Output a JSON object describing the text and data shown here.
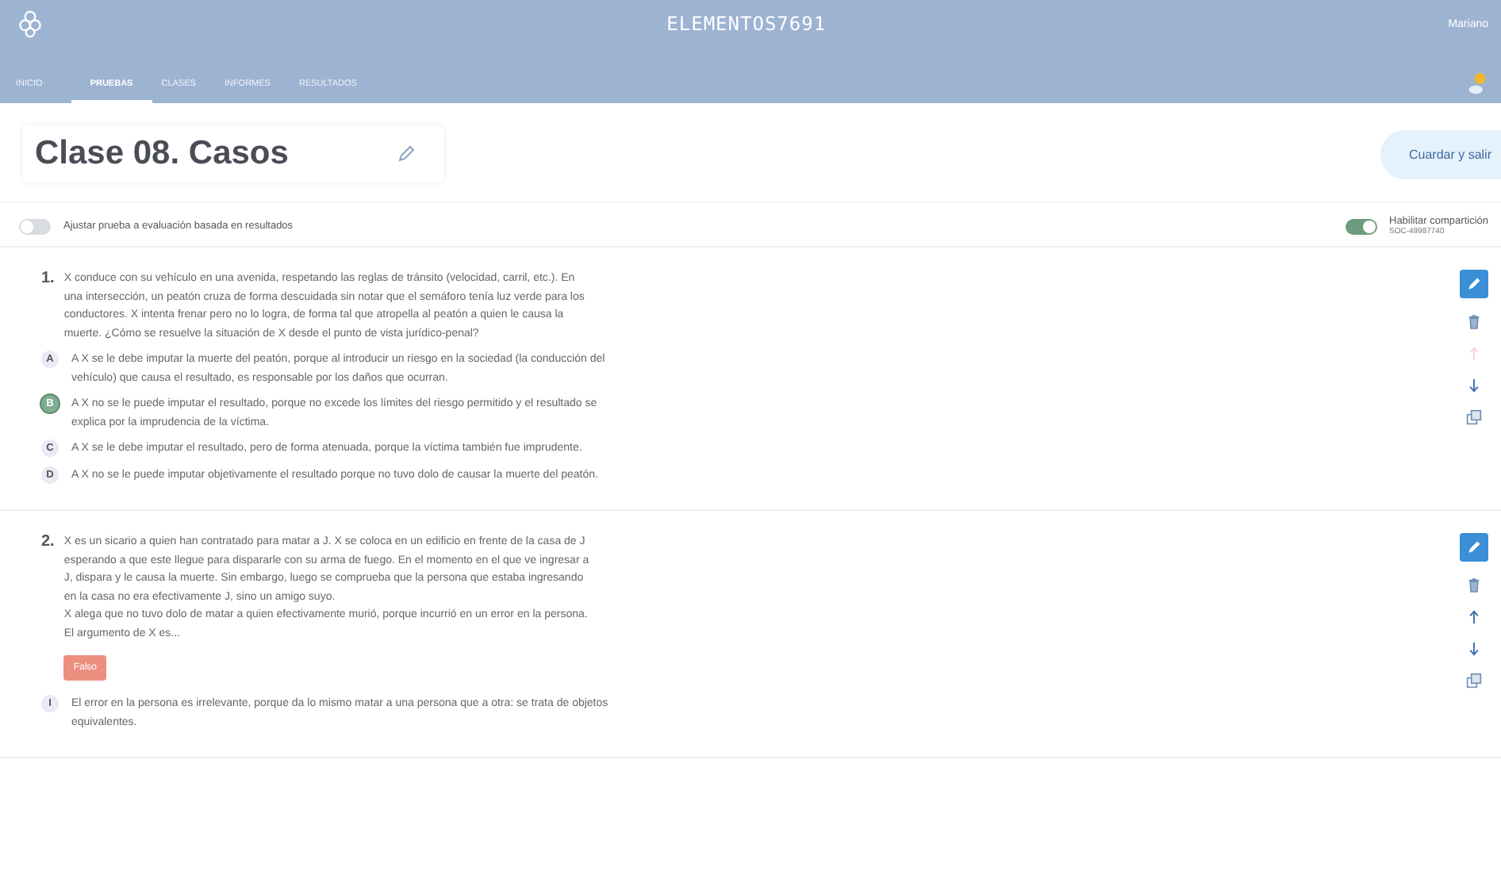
{
  "header": {
    "brand": "ELEMENTOS7691",
    "user": "Mariano",
    "notifications": true,
    "tabs": [
      {
        "label": "INICIO",
        "selected": false
      },
      {
        "label": "PRUEBAS",
        "selected": true
      },
      {
        "label": "CLASES",
        "selected": false
      },
      {
        "label": "INFORMES",
        "selected": false
      },
      {
        "label": "RESULTADOS",
        "selected": false
      }
    ]
  },
  "title": "Clase 08. Casos",
  "save_button": "Cuardar y salir",
  "adjust_toggle": {
    "label": "Ajustar prueba a evaluación basada en resultados",
    "on": false
  },
  "share_toggle": {
    "label": "Habilitar compartición",
    "code": "SOC-49987740",
    "on": true
  },
  "questions": [
    {
      "number": "1.",
      "text": [
        "X conduce con su vehículo en una avenida, respetando las reglas de tránsito (velocidad, carril, etc.). En una intersección, un peatón cruza de forma descuidada sin notar que el semáforo tenía luz verde para los conductores. X intenta frenar pero no lo logra, de forma tal que atropella al peatón a quien le causa la muerte. ¿Cómo se resuelve la situación de X desde el punto de vista jurídico-penal?"
      ],
      "move_up_disabled": true,
      "options": [
        {
          "letter": "A",
          "text": "A X se le debe imputar la muerte del peatón, porque al introducir un riesgo en la sociedad (la conducción del vehículo) que causa el resultado, es responsable por los daños que ocurran.",
          "selected": false
        },
        {
          "letter": "B",
          "text": "A X no se le puede imputar el resultado, porque no excede los límites del riesgo permitido y el resultado se explica por la imprudencia de la víctima.",
          "selected": true
        },
        {
          "letter": "C",
          "text": "A X se le debe imputar el resultado, pero de forma atenuada, porque la víctima también fue imprudente.",
          "selected": false
        },
        {
          "letter": "D",
          "text": "A X no se le puede imputar objetivamente el resultado porque no tuvo dolo de causar la muerte del peatón.",
          "selected": false
        }
      ]
    },
    {
      "number": "2.",
      "text": [
        "X es un sicario a quien han contratado para matar a J. X se coloca en un edificio en frente de la casa de J esperando a que este llegue para dispararle con su arma de fuego. En el momento en el que ve ingresar a J, dispara y le causa la muerte. Sin embargo, luego se comprueba que la persona que estaba ingresando en la casa no era efectivamente J, sino un amigo suyo.",
        "X alega que no tuvo dolo de matar a quien efectivamente murió, porque incurrió en un error en la persona.",
        "El argumento de X es..."
      ],
      "badge": "Falso",
      "move_up_disabled": false,
      "options": [
        {
          "letter": "I",
          "text": "El error en la persona es irrelevante, porque da lo mismo matar a una persona que a otra: se trata de objetos equivalentes.",
          "selected": false
        }
      ]
    }
  ]
}
